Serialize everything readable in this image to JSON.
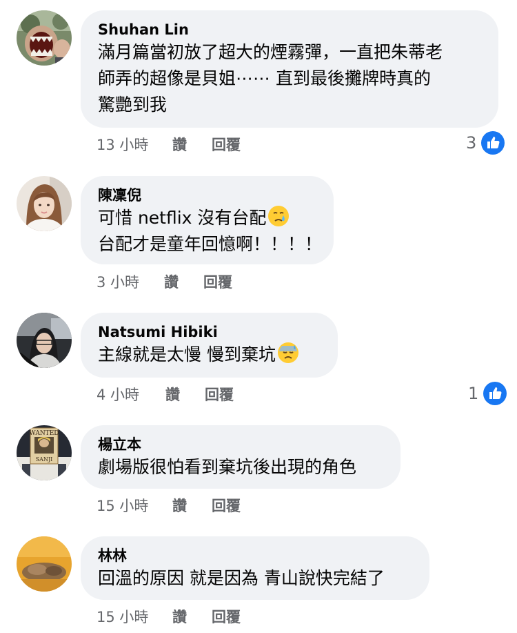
{
  "colors": {
    "bubble": "#f0f2f5",
    "meta_text": "#65676b",
    "like_blue": "#1877f2"
  },
  "comments": [
    {
      "author": "Shuhan Lin",
      "lines": [
        "滿月篇當初放了超大的煙霧彈，一直把朱蒂老",
        "師弄的超像是貝姐⋯⋯ 直到最後攤牌時真的",
        "驚艷到我"
      ],
      "time": "13 小時",
      "like_label": "讚",
      "reply_label": "回覆",
      "reaction_count": "3",
      "reaction_icon": "thumbs-up-icon"
    },
    {
      "author": "陳凜倪",
      "lines": [
        "可惜 netflix 沒有台配",
        "台配才是童年回憶啊！！！！"
      ],
      "emoji": "crying-face-emoji",
      "time": "3 小時",
      "like_label": "讚",
      "reply_label": "回覆"
    },
    {
      "author": "Natsumi Hibiki",
      "lines": [
        "主線就是太慢 慢到棄坑"
      ],
      "emoji": "sad-sweat-face-emoji",
      "time": "4 小時",
      "like_label": "讚",
      "reply_label": "回覆",
      "reaction_count": "1",
      "reaction_icon": "thumbs-up-icon"
    },
    {
      "author": "楊立本",
      "lines": [
        "劇場版很怕看到棄坑後出現的角色"
      ],
      "avatar_text": [
        "WANTED",
        "SANJI"
      ],
      "time": "15 小時",
      "like_label": "讚",
      "reply_label": "回覆"
    },
    {
      "author": "林林",
      "lines": [
        "回溫的原因 就是因為 青山說快完結了"
      ],
      "time": "15 小時",
      "like_label": "讚",
      "reply_label": "回覆"
    }
  ]
}
